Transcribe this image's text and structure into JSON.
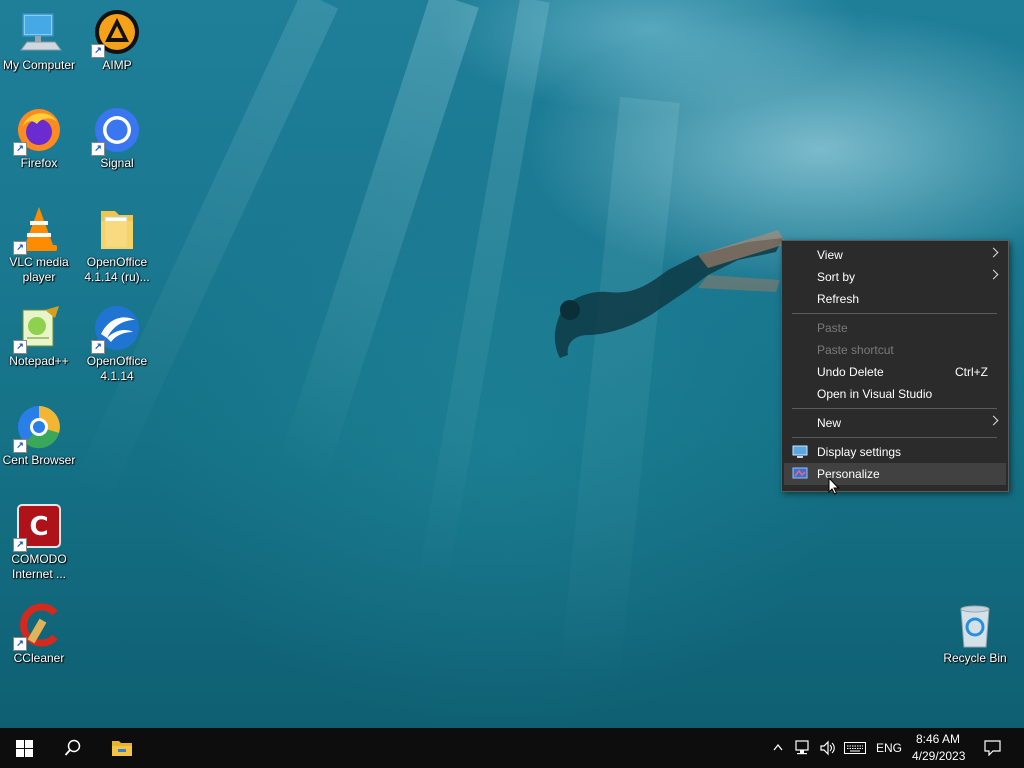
{
  "desktop_icons": [
    {
      "label": "My Computer",
      "icon": "computer-icon"
    },
    {
      "label": "AIMP",
      "icon": "aimp-icon"
    },
    {
      "label": "Firefox",
      "icon": "firefox-icon"
    },
    {
      "label": "Signal",
      "icon": "signal-icon"
    },
    {
      "label_line1": "VLC media",
      "label_line2": "player",
      "icon": "vlc-icon"
    },
    {
      "label_line1": "OpenOffice",
      "label_line2": "4.1.14 (ru)...",
      "icon": "folder-icon"
    },
    {
      "label": "Notepad++",
      "icon": "notepadpp-icon"
    },
    {
      "label_line1": "OpenOffice",
      "label_line2": "4.1.14",
      "icon": "openoffice-icon"
    },
    {
      "label": "Cent Browser",
      "icon": "centbrowser-icon"
    },
    {
      "label_line1": "COMODO",
      "label_line2": "Internet ...",
      "icon": "comodo-icon"
    },
    {
      "label": "CCleaner",
      "icon": "ccleaner-icon"
    },
    {
      "label": "Recycle Bin",
      "icon": "recycle-bin-icon"
    }
  ],
  "context_menu": {
    "items": [
      {
        "label": "View",
        "submenu": true,
        "enabled": true
      },
      {
        "label": "Sort by",
        "submenu": true,
        "enabled": true
      },
      {
        "label": "Refresh",
        "enabled": true
      },
      {
        "label": "Paste",
        "enabled": false
      },
      {
        "label": "Paste shortcut",
        "enabled": false
      },
      {
        "label": "Undo Delete",
        "shortcut": "Ctrl+Z",
        "enabled": true
      },
      {
        "label": "Open in Visual Studio",
        "enabled": true
      },
      {
        "label": "New",
        "submenu": true,
        "enabled": true
      },
      {
        "label": "Display settings",
        "icon": "display-icon",
        "enabled": true
      },
      {
        "label": "Personalize",
        "icon": "personalize-icon",
        "enabled": true,
        "highlighted": true
      }
    ]
  },
  "taskbar": {
    "start": "windows-logo-icon",
    "search": "search-icon",
    "pinned": [
      "file-explorer-icon"
    ],
    "tray": {
      "language": "ENG",
      "time": "8:46 AM",
      "date": "4/29/2023"
    }
  },
  "colors": {
    "taskbar": "#0d0d0d",
    "menu_bg": "#2b2b2b",
    "menu_highlight": "#414141",
    "explorer_yellow": "#f4c542"
  }
}
